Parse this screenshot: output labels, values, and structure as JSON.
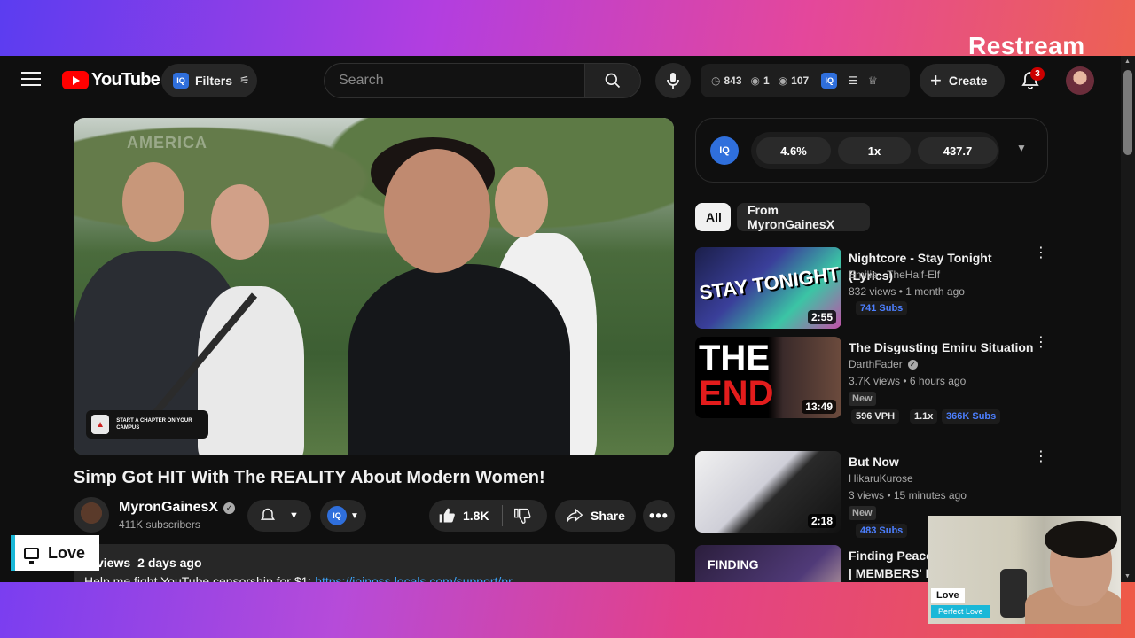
{
  "overlay": {
    "brand": "Restream",
    "side_label": "Love",
    "webcam": {
      "name": "Love",
      "subtitle": "Perfect Love"
    }
  },
  "topbar": {
    "logo_text": "YouTube",
    "filters_label": "Filters",
    "iq_badge": "IQ",
    "search_placeholder": "Search",
    "stats": {
      "clock": "843",
      "viewers": "1",
      "eye": "107"
    },
    "create_label": "Create",
    "notifications": "3"
  },
  "video": {
    "title": "Simp Got HIT With The REALITY About Modern Women!",
    "watermark": "AMERICA",
    "banner_text": "START A CHAPTER ON YOUR CAMPUS",
    "channel": {
      "name": "MyronGainesX",
      "subscribers": "411K subscribers"
    },
    "likes": "1.8K",
    "share_label": "Share",
    "description": {
      "views": "K views",
      "date": "2 days ago",
      "line_text": "Help me fight YouTube censorship for $1: ",
      "link": "https://joinoss.locals.com/support/pr"
    }
  },
  "iq_panel": {
    "icon": "IQ",
    "metrics": [
      "4.6%",
      "1x",
      "437.7"
    ]
  },
  "chips": {
    "all": "All",
    "from": "From MyronGainesX"
  },
  "recommendations": [
    {
      "title": "Nightcore - Stay Tonight (Lyrics)",
      "channel": "Emilia - TheHalf-Elf",
      "views": "832 views • 1 month ago",
      "duration": "2:55",
      "thumb_text": "STAY TONIGHT",
      "subs": "741 Subs"
    },
    {
      "title": "The Disgusting Emiru Situation",
      "channel": "DarthFader",
      "views": "3.7K views • 6 hours ago",
      "duration": "13:49",
      "thumb_text_1": "THE",
      "thumb_text_2": "END",
      "badge": "New",
      "vph": "596 VPH",
      "mult": "1.1x",
      "subs": "366K Subs"
    },
    {
      "title": "But Now",
      "channel": "HikaruKurose",
      "views": "3 views • 15 minutes ago",
      "duration": "2:18",
      "badge": "New",
      "subs": "483 Subs"
    },
    {
      "title": "Finding Peace",
      "title_2": "| MEMBERS' LI",
      "thumb_text": "FINDING"
    }
  ]
}
